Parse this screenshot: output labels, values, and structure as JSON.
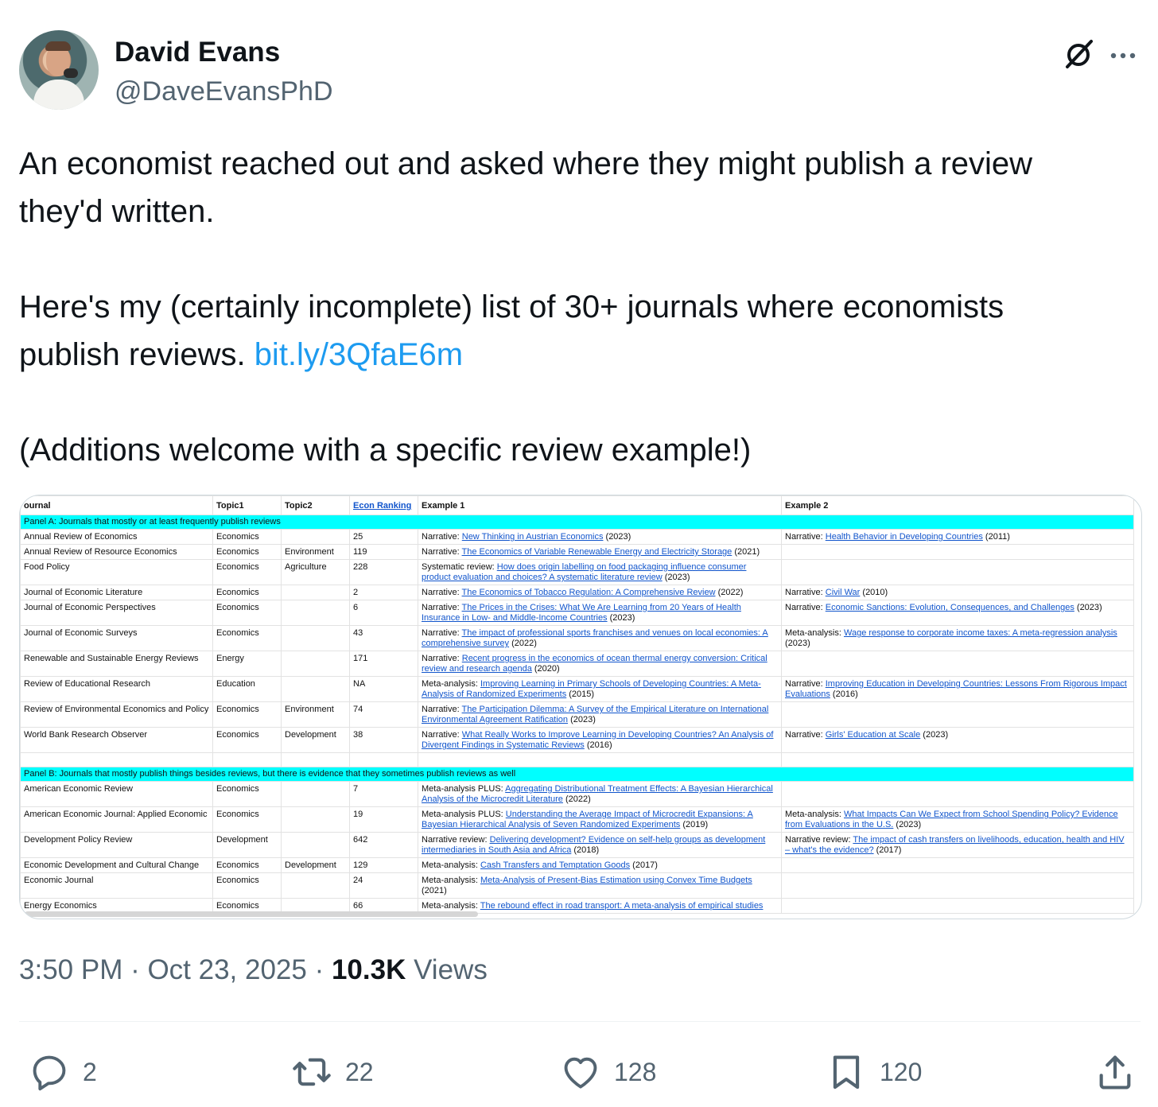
{
  "author": {
    "name": "David Evans",
    "handle": "@DaveEvansPhD"
  },
  "tweet": {
    "line1": "An economist reached out and asked where they might publish a review",
    "line2": "they'd written.",
    "line3": "Here's my (certainly incomplete) list of 30+ journals where economists",
    "line4_prefix": "publish reviews. ",
    "link": "bit.ly/3QfaE6m",
    "line5": "(Additions welcome with a specific review example!)"
  },
  "sheet": {
    "headers": [
      "ournal",
      "Topic1",
      "Topic2",
      "Econ Ranking",
      "Example 1",
      "Example 2"
    ],
    "panel_a": "Panel A: Journals that mostly or at least frequently publish reviews",
    "panel_b": "Panel B: Journals that mostly publish things besides reviews, but there is evidence that they sometimes publish reviews as well",
    "rows_a": [
      {
        "journal": "Annual Review of Economics",
        "t1": "Economics",
        "t2": "",
        "rank": "25",
        "e1_label": "Narrative: ",
        "e1_link": "New Thinking in Austrian Economics",
        "e1_year": " (2023)",
        "e2_label": "Narrative: ",
        "e2_link": "Health Behavior in Developing Countries",
        "e2_year": " (2011)"
      },
      {
        "journal": "Annual Review of Resource Economics",
        "t1": "Economics",
        "t2": "Environment",
        "rank": "119",
        "e1_label": "Narrative: ",
        "e1_link": "The Economics of Variable Renewable Energy and Electricity Storage",
        "e1_year": " (2021)",
        "e2_label": "",
        "e2_link": "",
        "e2_year": ""
      },
      {
        "journal": "Food Policy",
        "t1": "Economics",
        "t2": "Agriculture",
        "rank": "228",
        "e1_label": "Systematic review: ",
        "e1_link": "How does origin labelling on food packaging influence consumer product evaluation and choices? A systematic literature review",
        "e1_year": " (2023)",
        "e2_label": "",
        "e2_link": "",
        "e2_year": ""
      },
      {
        "journal": "Journal of Economic Literature",
        "t1": "Economics",
        "t2": "",
        "rank": "2",
        "e1_label": "Narrative: ",
        "e1_link": "The Economics of Tobacco Regulation: A Comprehensive Review",
        "e1_year": " (2022)",
        "e2_label": "Narrative: ",
        "e2_link": "Civil War",
        "e2_year": " (2010)"
      },
      {
        "journal": "Journal of Economic Perspectives",
        "t1": "Economics",
        "t2": "",
        "rank": "6",
        "e1_label": "Narrative: ",
        "e1_link": "The Prices in the Crises: What We Are Learning from 20 Years of Health Insurance in Low- and Middle-Income Countries",
        "e1_year": " (2023)",
        "e2_label": "Narrative: ",
        "e2_link": "Economic Sanctions: Evolution, Consequences, and Challenges",
        "e2_year": " (2023)"
      },
      {
        "journal": "Journal of Economic Surveys",
        "t1": "Economics",
        "t2": "",
        "rank": "43",
        "e1_label": "Narrative: ",
        "e1_link": "The impact of professional sports franchises and venues on local economies: A comprehensive survey",
        "e1_year": " (2022)",
        "e2_label": "Meta-analysis: ",
        "e2_link": "Wage response to corporate income taxes: A meta-regression analysis",
        "e2_year": " (2023)"
      },
      {
        "journal": "Renewable and Sustainable Energy Reviews",
        "t1": "Energy",
        "t2": "",
        "rank": "171",
        "e1_label": "Narrative: ",
        "e1_link": "Recent progress in the economics of ocean thermal energy conversion: Critical review and research agenda",
        "e1_year": " (2020)",
        "e2_label": "",
        "e2_link": "",
        "e2_year": ""
      },
      {
        "journal": "Review of Educational Research",
        "t1": "Education",
        "t2": "",
        "rank": "NA",
        "e1_label": "Meta-analysis: ",
        "e1_link": "Improving Learning in Primary Schools of Developing Countries: A Meta-Analysis of Randomized Experiments",
        "e1_year": " (2015)",
        "e2_label": "Narrative: ",
        "e2_link": "Improving Education in Developing Countries: Lessons From Rigorous Impact Evaluations",
        "e2_year": " (2016)"
      },
      {
        "journal": "Review of Environmental Economics and Policy",
        "t1": "Economics",
        "t2": "Environment",
        "rank": "74",
        "e1_label": "Narrative: ",
        "e1_link": "The Participation Dilemma: A Survey of the Empirical Literature on International Environmental Agreement Ratification",
        "e1_year": " (2023)",
        "e2_label": "",
        "e2_link": "",
        "e2_year": ""
      },
      {
        "journal": "World Bank Research Observer",
        "t1": "Economics",
        "t2": "Development",
        "rank": "38",
        "e1_label": "Narrative: ",
        "e1_link": "What Really Works to Improve Learning in Developing Countries? An Analysis of Divergent Findings in Systematic Reviews",
        "e1_year": " (2016)",
        "e2_label": "Narrative: ",
        "e2_link": "Girls' Education at Scale",
        "e2_year": " (2023)"
      }
    ],
    "rows_b": [
      {
        "journal": "American Economic Review",
        "t1": "Economics",
        "t2": "",
        "rank": "7",
        "e1_label": "Meta-analysis PLUS: ",
        "e1_link": "Aggregating Distributional Treatment Effects: A Bayesian Hierarchical Analysis of the Microcredit Literature",
        "e1_year": " (2022)",
        "e2_label": "",
        "e2_link": "",
        "e2_year": ""
      },
      {
        "journal": "American Economic Journal: Applied Economic",
        "t1": "Economics",
        "t2": "",
        "rank": "19",
        "e1_label": "Meta-analysis PLUS: ",
        "e1_link": "Understanding the Average Impact of Microcredit Expansions: A Bayesian Hierarchical Analysis of Seven Randomized Experiments",
        "e1_year": " (2019)",
        "e2_label": "Meta-analysis: ",
        "e2_link": "What Impacts Can We Expect from School Spending Policy? Evidence from Evaluations in the U.S.",
        "e2_year": " (2023)"
      },
      {
        "journal": "Development Policy Review",
        "t1": "Development",
        "t2": "",
        "rank": "642",
        "e1_label": "Narrative review: ",
        "e1_link": "Delivering development? Evidence on self-help groups as development intermediaries in South Asia and Africa",
        "e1_year": " (2018)",
        "e2_label": "Narrative review: ",
        "e2_link": "The impact of cash transfers on livelihoods, education, health and HIV – what's the evidence?",
        "e2_year": " (2017)"
      },
      {
        "journal": "Economic Development and Cultural Change",
        "t1": "Economics",
        "t2": "Development",
        "rank": "129",
        "e1_label": "Meta-analysis: ",
        "e1_link": "Cash Transfers and Temptation Goods",
        "e1_year": " (2017)",
        "e2_label": "",
        "e2_link": "",
        "e2_year": ""
      },
      {
        "journal": "Economic Journal",
        "t1": "Economics",
        "t2": "",
        "rank": "24",
        "e1_label": "Meta-analysis: ",
        "e1_link": "Meta-Analysis of Present-Bias Estimation using Convex Time Budgets",
        "e1_year": " (2021)",
        "e2_label": "",
        "e2_link": "",
        "e2_year": ""
      },
      {
        "journal": "Energy Economics",
        "t1": "Economics",
        "t2": "",
        "rank": "66",
        "e1_label": "Meta-analysis: ",
        "e1_link": "The rebound effect in road transport: A meta-analysis of empirical studies",
        "e1_year": "",
        "e2_label": "",
        "e2_link": "",
        "e2_year": ""
      }
    ]
  },
  "meta": {
    "time": "3:50 PM · Oct 23, 2025 · ",
    "views_count": "10.3K",
    "views_label": " Views"
  },
  "actions": {
    "replies": "2",
    "reposts": "22",
    "likes": "128",
    "bookmarks": "120"
  },
  "icons": [
    "grok-icon",
    "more-icon",
    "reply-icon",
    "repost-icon",
    "like-icon",
    "bookmark-icon",
    "share-icon"
  ],
  "colors": {
    "link": "#1d9bf0",
    "panel": "#00ffff",
    "muted": "#536471",
    "sheet_link": "#1155cc"
  }
}
